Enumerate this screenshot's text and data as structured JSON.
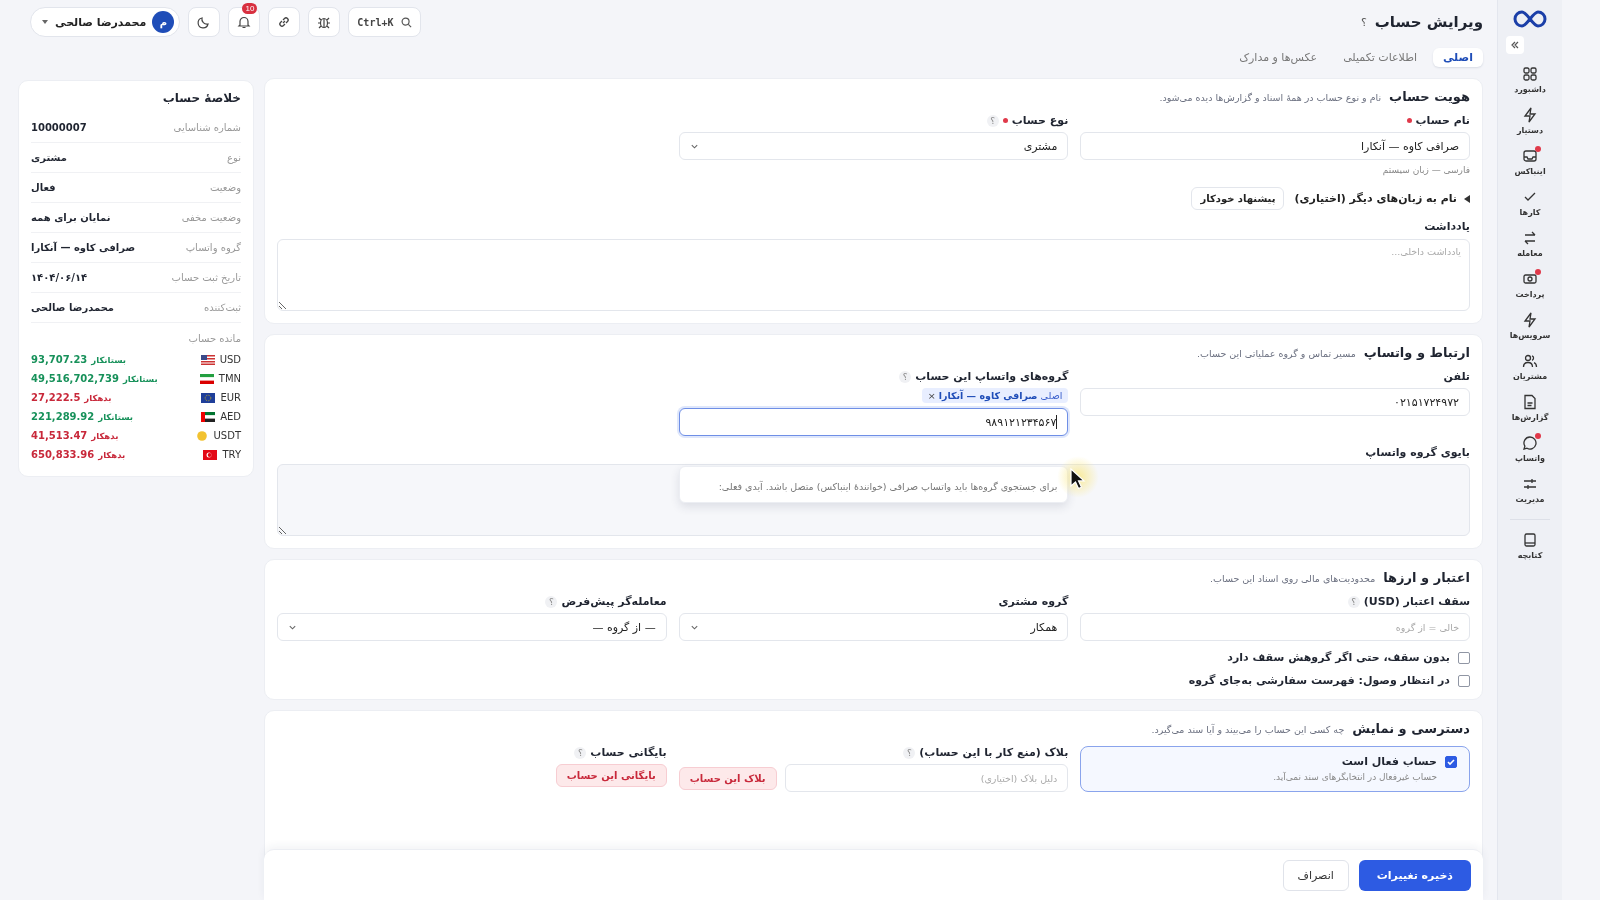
{
  "topbar": {
    "title": "ویرایش حساب",
    "help": "؟",
    "search_shortcut": "Ctrl+K",
    "notification_count": "10",
    "user": {
      "name": "محمدرضا صالحی",
      "initial": "م"
    }
  },
  "sidebar": {
    "items": [
      {
        "label": "داشبورد",
        "dot": false
      },
      {
        "label": "دستیار",
        "dot": false
      },
      {
        "label": "اینباکس",
        "dot": true
      },
      {
        "label": "کارها",
        "dot": false
      },
      {
        "label": "معامله",
        "dot": false
      },
      {
        "label": "پرداخت",
        "dot": true
      },
      {
        "label": "سرویس‌ها",
        "dot": false
      },
      {
        "label": "مشتریان",
        "dot": false
      },
      {
        "label": "گزارش‌ها",
        "dot": false
      },
      {
        "label": "واتساپ",
        "dot": true
      },
      {
        "label": "مدیریت",
        "dot": false
      }
    ],
    "footer_item": {
      "label": "کتابچه"
    }
  },
  "tabs": [
    {
      "label": "اصلی",
      "selected": true
    },
    {
      "label": "اطلاعات تکمیلی",
      "selected": false
    },
    {
      "label": "عکس‌ها و مدارک",
      "selected": false
    }
  ],
  "identity": {
    "title": "هویت حساب",
    "subtitle": "نام و نوع حساب در همهٔ اسناد و گزارش‌ها دیده می‌شود.",
    "name_label": "نام حساب",
    "name_required": true,
    "name_value": "صرافی کاوه — آنکارا",
    "name_hint": "فارسی — زبان سیستم",
    "type_label": "نوع حساب",
    "type_required": true,
    "type_help": "؟",
    "type_value": "مشتری",
    "other_langs_label": "نام به زبان‌های دیگر (اختیاری)",
    "auto_button": "پیشنهاد خودکار",
    "note_label": "یادداشت",
    "note_placeholder": "یادداشت داخلی..."
  },
  "contact": {
    "title": "ارتباط و واتساپ",
    "subtitle": "مسیر تماس و گروه عملیاتی این حساب.",
    "phone_label": "تلفن",
    "phone_value": "۰۲۱۵۱۷۲۴۹۷۲",
    "groups_label": "گروه‌های واتساپ این حساب",
    "groups_help": "؟",
    "group_tags": [
      {
        "prefix": "اصلی",
        "name": "صرافی کاوه — آنکارا",
        "remove": "×"
      }
    ],
    "search_value": "۹۸۹۱۲۱۲۳۴۵۶۷",
    "dropdown_hint": "برای جستجوی گروه‌ها باید واتساپ صرافی (خوانندهٔ اینباکس) متصل باشد. آیدی فعلی:",
    "bio_label": "بایوی گروه واتساپ"
  },
  "credit": {
    "title": "اعتبار و ارزها",
    "subtitle": "محدودیت‌های مالی روی اسناد این حساب.",
    "limit_label": "سقف اعتبار (USD)",
    "limit_help": "؟",
    "limit_placeholder": "خالی = از گروه",
    "group_label": "گروه مشتری",
    "group_value": "همکار",
    "dealer_label": "معامله‌گر پیش‌فرض",
    "dealer_help": "؟",
    "dealer_value": "— از گروه —",
    "checkboxes": [
      {
        "label": "بدون سقف، حتی اگر گروهش سقف دارد",
        "checked": false
      },
      {
        "label": "در انتظار وصول: فهرست سفارشی به‌جای گروه",
        "checked": false
      }
    ]
  },
  "access": {
    "title": "دسترسی و نمایش",
    "subtitle": "چه کسی این حساب را می‌بیند و آیا سند می‌گیرد.",
    "active_label": "حساب فعال است",
    "active_checked": true,
    "active_hint": "حساب غیرفعال در انتخابگرهای سند نمی‌آید.",
    "block_label": "بلاک (منع کار با این حساب)",
    "block_help": "؟",
    "block_placeholder": "دلیل بلاک (اختیاری)",
    "block_button": "بلاک این حساب",
    "archive_label": "بایگانی حساب",
    "archive_help": "؟",
    "archive_button": "بایگانی این حساب"
  },
  "footer": {
    "save": "ذخیره تغییرات",
    "cancel": "انصراف"
  },
  "summary": {
    "title": "خلاصهٔ حساب",
    "rows": [
      {
        "label": "شماره شناسایی",
        "value": "10000007"
      },
      {
        "label": "نوع",
        "value": "مشتری"
      },
      {
        "label": "وضعیت",
        "value": "فعال"
      },
      {
        "label": "وضعیت مخفی",
        "value": "نمایان برای همه"
      },
      {
        "label": "گروه واتساپ",
        "value": "صرافی کاوه — آنکارا"
      },
      {
        "label": "تاریخ ثبت حساب",
        "value": "۱۴۰۴/۰۶/۱۴"
      },
      {
        "label": "ثبت‌کننده",
        "value": "محمدرضا صالحی"
      }
    ],
    "balance_label": "مانده حساب",
    "balances": [
      {
        "currency": "USD",
        "side": "بستانکار",
        "amount": "93,707.23",
        "kind": "credit"
      },
      {
        "currency": "TMN",
        "side": "بستانکار",
        "amount": "49,516,702,739",
        "kind": "credit"
      },
      {
        "currency": "EUR",
        "side": "بدهکار",
        "amount": "27,222.5",
        "kind": "debit"
      },
      {
        "currency": "AED",
        "side": "بستانکار",
        "amount": "221,289.92",
        "kind": "credit"
      },
      {
        "currency": "USDT",
        "side": "بدهکار",
        "amount": "41,513.47",
        "kind": "debit"
      },
      {
        "currency": "TRY",
        "side": "بدهکار",
        "amount": "650,833.96",
        "kind": "debit"
      }
    ]
  }
}
